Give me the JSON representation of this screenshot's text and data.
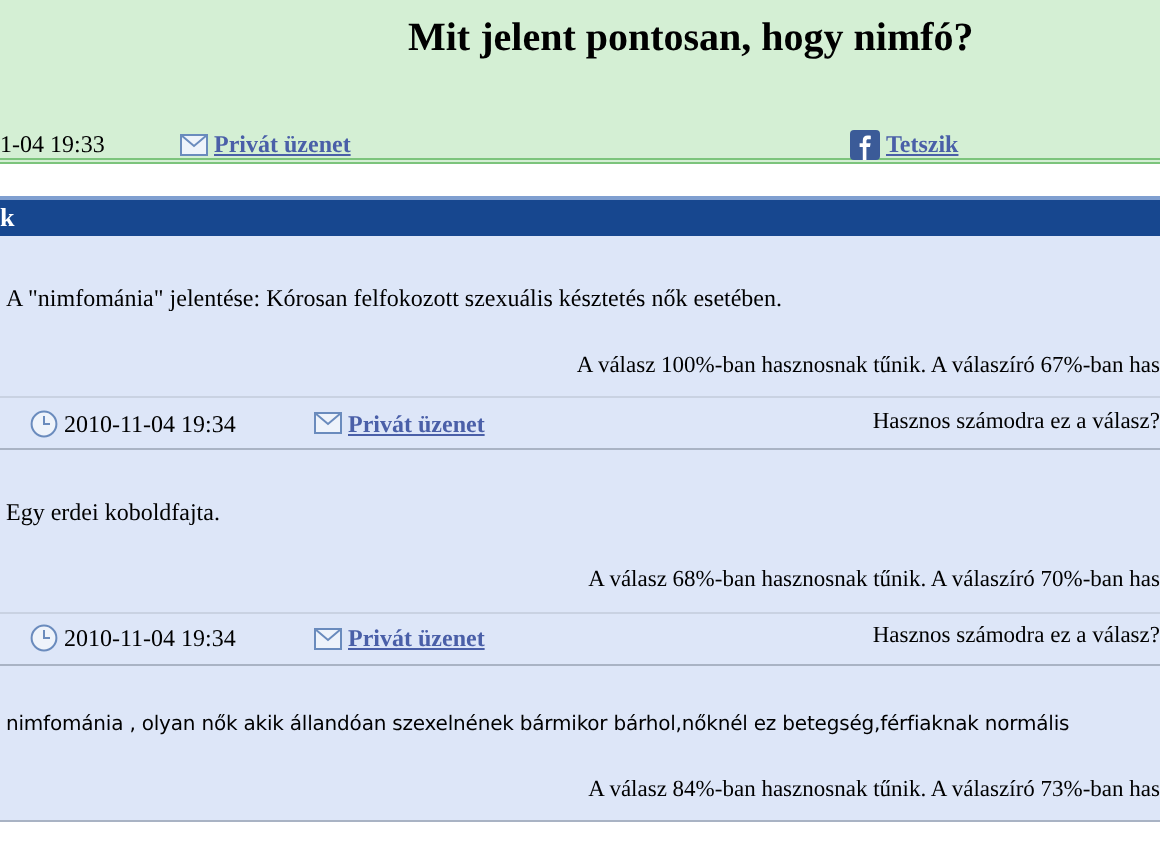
{
  "question": {
    "title": "Mit jelent pontosan, hogy nimfó?",
    "date": "1-04 19:33",
    "private_message": "Privát üzenet",
    "like": "Tetszik"
  },
  "answers_header": "k",
  "answers": [
    {
      "text": "A \"nimfománia\" jelentése: Kórosan felfokozott szexuális késztetés nők esetében.",
      "rating": "A válasz 100%-ban hasznosnak tűnik. A válaszíró 67%-ban has",
      "date": "2010-11-04 19:34",
      "private_message": "Privát üzenet",
      "useful": "Hasznos számodra ez a válasz?"
    },
    {
      "text": "Egy erdei koboldfajta.",
      "rating": "A válasz 68%-ban hasznosnak tűnik. A válaszíró 70%-ban has",
      "date": "2010-11-04 19:34",
      "private_message": "Privát üzenet",
      "useful": "Hasznos számodra ez a válasz?"
    },
    {
      "text": "nimfománia , olyan nők akik állandóan szexelnének bármikor bárhol,nőknél ez betegség,férfiaknak normális",
      "rating": "A válasz 84%-ban hasznosnak tűnik. A válaszíró 73%-ban has"
    }
  ]
}
